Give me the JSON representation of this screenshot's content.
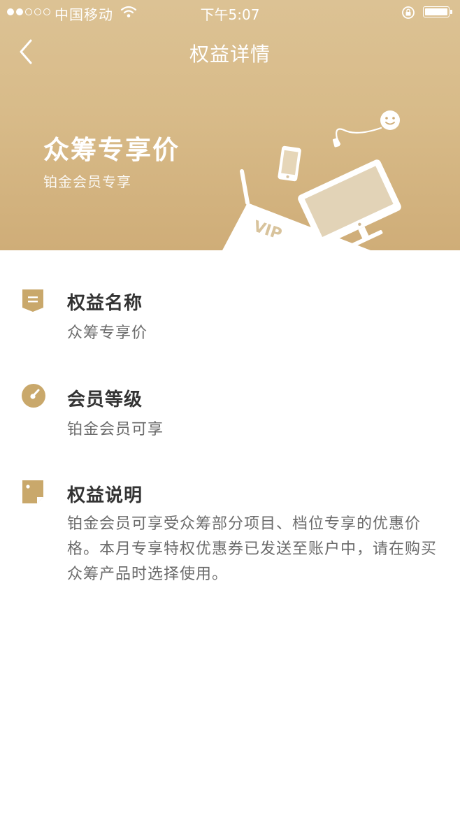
{
  "status_bar": {
    "carrier": "中国移动",
    "time": "下午5:07"
  },
  "nav": {
    "title": "权益详情",
    "back_icon": "chevron-left-icon"
  },
  "hero": {
    "title": "众筹专享价",
    "subtitle": "铂金会员专享",
    "badge_text": "VIP",
    "colors": {
      "gradient_top": "#dcc294",
      "gradient_bottom": "#cfad78"
    }
  },
  "sections": [
    {
      "icon": "bookmark-icon",
      "title": "权益名称",
      "body": "众筹专享价"
    },
    {
      "icon": "gauge-icon",
      "title": "会员等级",
      "body": "铂金会员可享"
    },
    {
      "icon": "document-icon",
      "title": "权益说明",
      "body": "铂金会员可享受众筹部分项目、档位专享的优惠价格。本月专享特权优惠券已发送至账户中，请在购买众筹产品时选择使用。"
    }
  ],
  "accent_color": "#c9a86b"
}
